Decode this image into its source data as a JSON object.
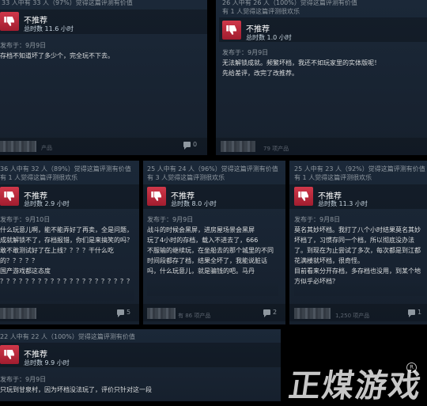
{
  "reviews": [
    {
      "helpful": "33 人中有 33 人（97%）觉得这篇评测有价值",
      "funny": "",
      "verdict": "不推荐",
      "hours": "总时数 11.6 小时",
      "date": "发布于：9月9日",
      "body": "存档不知道坏了多少个，完全玩不下去。",
      "products": "产品",
      "comments": "0"
    },
    {
      "helpful": "26 人中有 26 人（100%）觉得这篇评测有价值",
      "funny": "有 1 人觉得这篇评测很欢乐",
      "verdict": "不推荐",
      "hours": "总时数 1.0 小时",
      "date": "发布于：9月9日",
      "body": "无法解锁成就。频繁坏档，我还不如玩家里的实体版呢！\n先给差评，改完了改推荐。",
      "products": "79 项产品",
      "comments": ""
    },
    {
      "helpful": "36 人中有 32 人（89%）觉得这篇评测有价值",
      "funny": "有 1 人觉得这篇评测很欢乐",
      "verdict": "不推荐",
      "hours": "总时数 2.9 小时",
      "date": "发布于：9月10日",
      "body": "什么玩意儿啊，能不能弄好了再卖，全是问题，成就解锁不了，存档报错，你们是来搞笑的吗？敢不敢测试好了在上线？？？？干什么吃的？？？？？\n国产游戏都这态度\n？？？？？？？？？？？？？？？？？？？？？",
      "products": "",
      "comments": "5"
    },
    {
      "helpful": "25 人中有 24 人（96%）觉得这篇评测有价值",
      "funny": "有 3 人觉得这篇评测很欢乐",
      "verdict": "不推荐",
      "hours": "总时数 8.0 小时",
      "date": "发布于：9月9日",
      "body": "战斗的时候会黑屏，进房屋场景会黑屏\n玩了4小时的存档，载入不进去了，666\n不服输的继续玩，在坐船去的那个城里的不同时间段都存了档，结果全坏了，我能说脏话吗，什么玩意儿，就是骗钱的吧。马丹",
      "products": "有 86 项产品",
      "comments": "2"
    },
    {
      "helpful": "25 人中有 23 人（92%）觉得这篇评测有价值",
      "funny": "有 1 人觉得这篇评测很欢乐",
      "verdict": "不推荐",
      "hours": "总时数 11.3 小时",
      "date": "发布于：9月8日",
      "body": "莫名其妙坏档。我打了八个小时结果莫名其妙坏档了，习惯存同一个档，所以彻底没办法了。到现在为止尝试了多次，每次都是到江都花满楼就坏档，很奇怪。\n目前看来分开存档，多存档也没用，到某个地方似乎必坏档？",
      "products": "1,250 项产品",
      "comments": "1"
    },
    {
      "helpful": "22 人中有 22 人（100%）觉得这篇评测有价值",
      "funny": "",
      "verdict": "不推荐",
      "hours": "总时数 9.9 小时",
      "date": "发布于：9月9日",
      "body": "只玩到甘泉村，因为坏档没法玩了，评价只针对这一段",
      "products": "",
      "comments": ""
    }
  ],
  "watermark": {
    "text": "正煤游戏",
    "mark": "R"
  },
  "colors": {
    "card_bg": "#1b2838",
    "thumb_down": "#c82c3f",
    "text_light": "#dcdedf",
    "text_muted": "#8f98a0"
  }
}
